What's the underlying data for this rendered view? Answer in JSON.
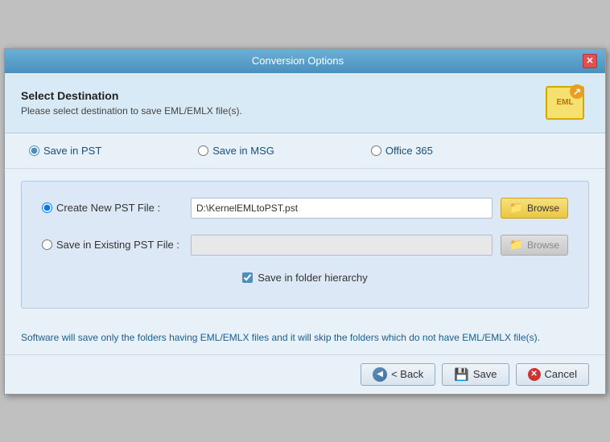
{
  "window": {
    "title": "Conversion Options"
  },
  "header": {
    "heading": "Select Destination",
    "subtext": "Please select destination to save EML/EMLX file(s).",
    "icon_label": "EML"
  },
  "radio_options": [
    {
      "id": "save-pst",
      "label": "Save in PST",
      "checked": true
    },
    {
      "id": "save-msg",
      "label": "Save in MSG",
      "checked": false
    },
    {
      "id": "office365",
      "label": "Office 365",
      "checked": false
    }
  ],
  "pst_section": {
    "create_new_label": "Create New PST File :",
    "create_new_value": "D:\\\\KernelEMLtoPST.pst",
    "create_new_placeholder": "",
    "save_existing_label": "Save in Existing PST File :",
    "save_existing_value": "",
    "save_existing_placeholder": "",
    "browse_label": "Browse",
    "browse_label2": "Browse",
    "checkbox_label": "Save in folder hierarchy",
    "checkbox_checked": true
  },
  "info_text": "Software will save only the folders having EML/EMLX files and it will skip the folders which do not have EML/EMLX file(s).",
  "footer": {
    "back_label": "< Back",
    "save_label": "Save",
    "cancel_label": "Cancel"
  }
}
